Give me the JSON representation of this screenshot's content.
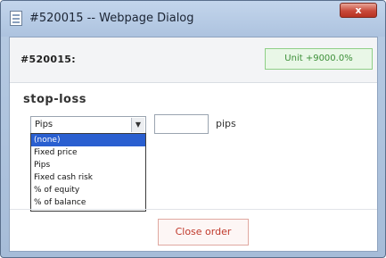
{
  "window": {
    "title": "#520015 -- Webpage Dialog",
    "close_glyph": "x"
  },
  "header": {
    "order_id": "#520015:",
    "unit_button_label": "Unit +9000.0%"
  },
  "stop_loss": {
    "label": "stop-loss",
    "selected": "Pips",
    "pips_value": "",
    "unit_label": "pips",
    "options": [
      {
        "label": "(none)",
        "highlighted": true
      },
      {
        "label": "Fixed price",
        "highlighted": false
      },
      {
        "label": "Pips",
        "highlighted": false
      },
      {
        "label": "Fixed cash risk",
        "highlighted": false
      },
      {
        "label": "% of equity",
        "highlighted": false
      },
      {
        "label": "% of balance",
        "highlighted": false
      }
    ]
  },
  "footer": {
    "close_order_label": "Close order"
  },
  "colors": {
    "highlight": "#2a5fd0",
    "close_button": "#c0392b",
    "unit_button": "#3c8f38"
  }
}
